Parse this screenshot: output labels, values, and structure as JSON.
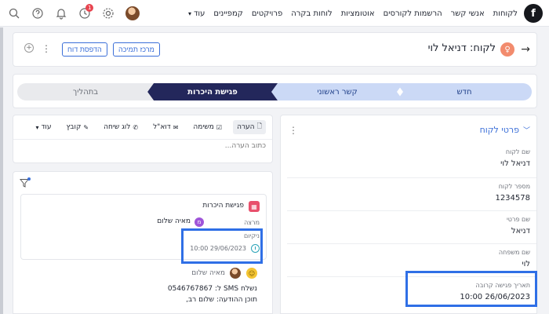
{
  "nav": {
    "logo": "f",
    "items": [
      "לקוחות",
      "אנשי קשר",
      "הרשמות לקורסים",
      "אוטומציות",
      "לוחות בקרה",
      "פרויקטים",
      "קמפיינים"
    ],
    "more_label": "עוד",
    "notification_count": "1"
  },
  "header": {
    "title": "לקוח: דניאל לוי",
    "print_button": "הדפסת דוח",
    "support_button": "מרכז תמיכה"
  },
  "pipeline": {
    "stages": [
      {
        "label": "חדש",
        "state": "done"
      },
      {
        "label": "קשר ראשוני",
        "state": "done"
      },
      {
        "label": "פגישת היכרות",
        "state": "current"
      },
      {
        "label": "בתהליך",
        "state": "pending"
      }
    ]
  },
  "details": {
    "title": "פרטי לקוח",
    "fields": [
      {
        "label": "שם לקוח",
        "value": "דניאל לוי"
      },
      {
        "label": "מספר לקוח",
        "value": "1234578"
      },
      {
        "label": "שם פרטי",
        "value": "דניאל"
      },
      {
        "label": "שם משפחה",
        "value": "לוי"
      },
      {
        "label": "תאריך פגישה קרובה",
        "value": "26/06/2023 10:00"
      }
    ]
  },
  "composer": {
    "tabs": [
      "הערה",
      "משימה",
      "דוא\"ל",
      "לוג שיחה",
      "קובץ",
      "עוד"
    ],
    "placeholder": "כתוב הערה..."
  },
  "feed": {
    "card": {
      "title": "פגישת היכרות",
      "assigned_label": "מרצה",
      "assignee_initial": "מ",
      "assignee": "מאיה שלום",
      "deadline_label": "ניקיום",
      "deadline": "29/06/2023 10:00"
    },
    "sms": {
      "author": "מאיה שלום",
      "line1": "נשלח SMS ל: 0546767867",
      "line2": "תוכן ההודעה: שלום רב,"
    }
  },
  "colors": {
    "accent": "#3b6fd8",
    "current_stage": "#23275b",
    "done_stage": "#cbd9f6",
    "highlight": "#2f6fe6"
  }
}
